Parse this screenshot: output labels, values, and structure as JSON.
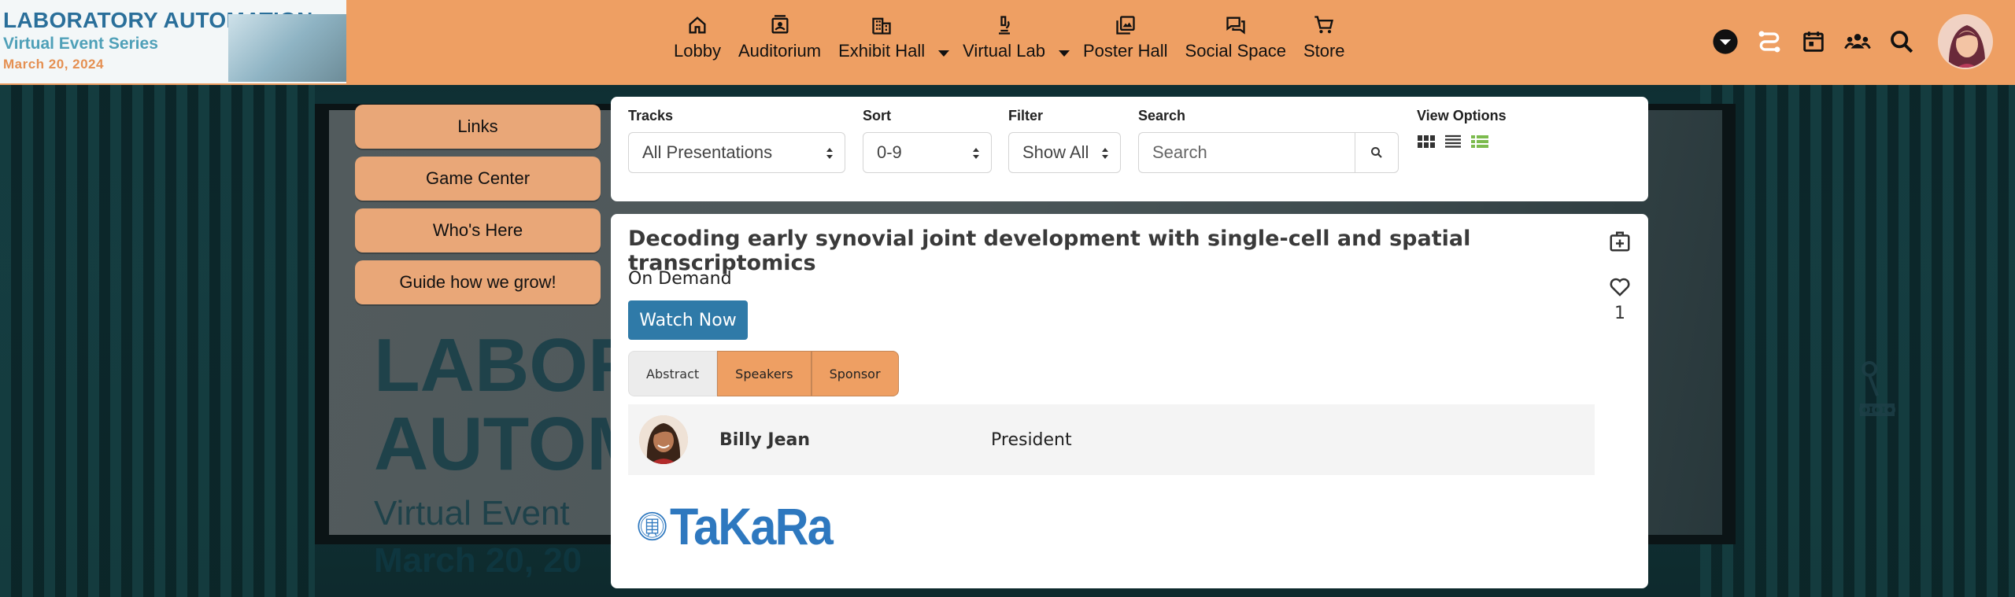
{
  "logo": {
    "title": "LABORATORY AUTOMATION",
    "subtitle": "Virtual Event Series",
    "date": "March 20, 2024"
  },
  "nav": {
    "items": [
      {
        "label": "Lobby",
        "icon": "home-icon"
      },
      {
        "label": "Auditorium",
        "icon": "auditorium-icon"
      },
      {
        "label": "Exhibit Hall",
        "icon": "building-icon"
      },
      {
        "label": "Virtual Lab",
        "icon": "microscope-icon"
      },
      {
        "label": "Poster Hall",
        "icon": "poster-icon"
      },
      {
        "label": "Social Space",
        "icon": "chat-icon"
      },
      {
        "label": "Store",
        "icon": "cart-icon"
      }
    ]
  },
  "sidebar": {
    "items": [
      {
        "label": "Links"
      },
      {
        "label": "Game Center"
      },
      {
        "label": "Who's Here"
      },
      {
        "label": "Guide how we grow!"
      }
    ]
  },
  "filters": {
    "tracks_label": "Tracks",
    "tracks_value": "All Presentations",
    "sort_label": "Sort",
    "sort_value": "0-9",
    "filter_label": "Filter",
    "filter_value": "Show All",
    "search_label": "Search",
    "search_placeholder": "Search",
    "view_label": "View Options"
  },
  "session": {
    "title": "Decoding early synovial joint development with single-cell and spatial transcriptomics",
    "status": "On Demand",
    "watch_label": "Watch Now",
    "like_count": "1",
    "tabs": [
      "Abstract",
      "Speakers",
      "Sponsor"
    ],
    "speaker": {
      "name": "Billy Jean",
      "role": "President"
    },
    "sponsor_name": "TaKaRa"
  },
  "background": {
    "line1": "LABOR",
    "line2": "AUTOM",
    "line3": "Virtual Event",
    "line4": "March 20, 20"
  },
  "colors": {
    "topbar": "#ee9f63",
    "side_button": "#e9a778",
    "watch_button": "#2f7aa8",
    "sponsor_blue": "#2e78bf"
  }
}
